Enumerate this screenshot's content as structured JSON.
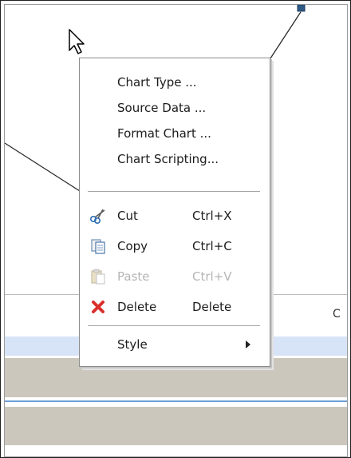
{
  "context_menu": {
    "items": [
      {
        "label": "Chart Type ...",
        "icon": "",
        "shortcut": ""
      },
      {
        "label": "Source Data ...",
        "icon": "",
        "shortcut": ""
      },
      {
        "label": "Format Chart ...",
        "icon": "",
        "shortcut": ""
      },
      {
        "label": "Chart Scripting...",
        "icon": "",
        "shortcut": ""
      }
    ],
    "edit_items": [
      {
        "label": "Cut",
        "shortcut": "Ctrl+X",
        "icon": "scissors-icon",
        "enabled": true
      },
      {
        "label": "Copy",
        "shortcut": "Ctrl+C",
        "icon": "copy-icon",
        "enabled": true
      },
      {
        "label": "Paste",
        "shortcut": "Ctrl+V",
        "icon": "paste-icon",
        "enabled": false
      },
      {
        "label": "Delete",
        "shortcut": "Delete",
        "icon": "delete-x-icon",
        "enabled": true
      }
    ],
    "style_item": {
      "label": "Style",
      "has_submenu": true
    }
  },
  "sheet": {
    "column_letter": "C"
  },
  "colors": {
    "selection_band": "#d7e3f6",
    "row_band": "#cbc7bd",
    "accent_blue": "#6f9fd8",
    "delete_red": "#d9302c",
    "disabled_text": "#b5b5b5"
  }
}
